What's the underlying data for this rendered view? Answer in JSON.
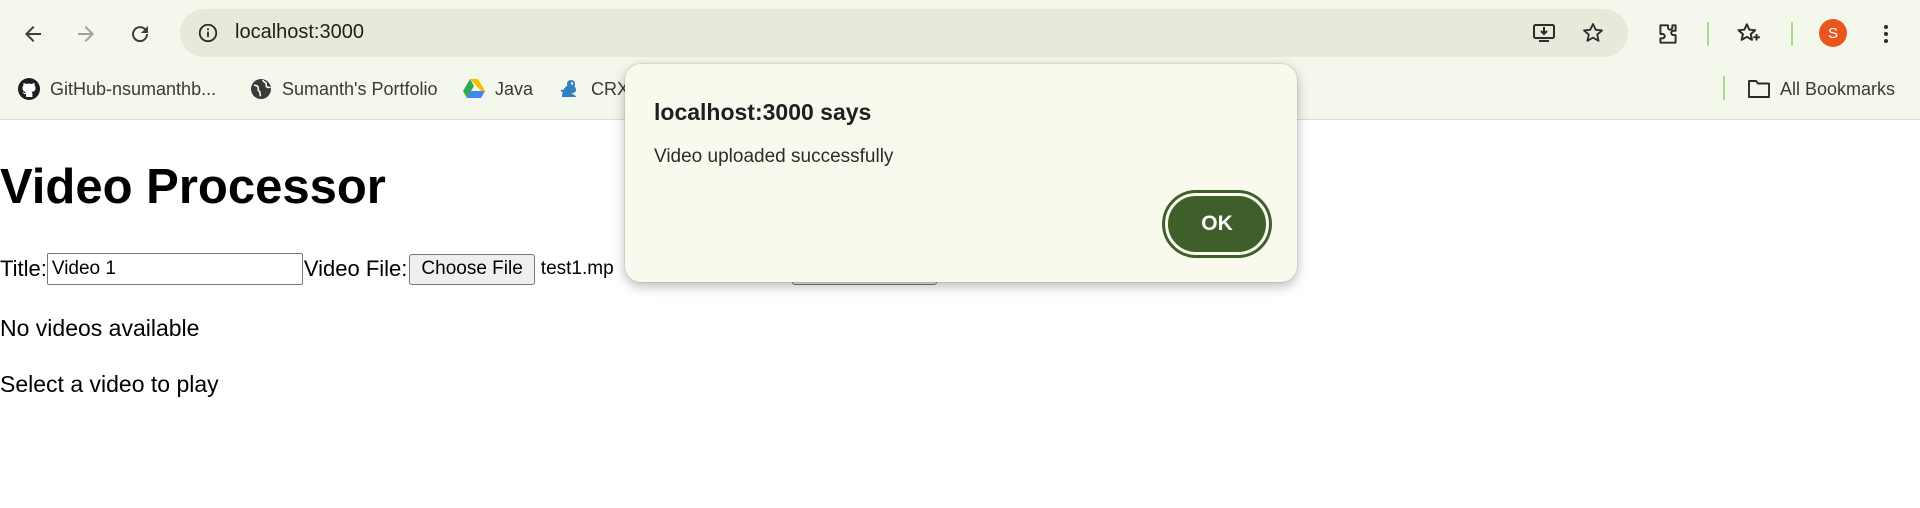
{
  "browser": {
    "url": "localhost:3000",
    "avatar_letter": "S",
    "accent_color": "#3e5f2a",
    "bookmarks": [
      {
        "label": "GitHub-nsumanthb...",
        "icon": "github-icon"
      },
      {
        "label": "Sumanth's Portfolio",
        "icon": "globe-icon"
      },
      {
        "label": "Java",
        "icon": "google-drive-icon"
      },
      {
        "label": "CRX",
        "icon": "crx-icon"
      }
    ],
    "all_bookmarks_label": "All Bookmarks"
  },
  "page": {
    "title": "Video Processor",
    "title_label": "Title:",
    "title_value": "Video 1",
    "file_label": "Video File:",
    "choose_file_label": "Choose File",
    "file_name": "test1.mp",
    "empty_message": "No videos available",
    "select_message": "Select a video to play"
  },
  "dialog": {
    "title": "localhost:3000 says",
    "message": "Video uploaded successfully",
    "ok_label": "OK"
  }
}
